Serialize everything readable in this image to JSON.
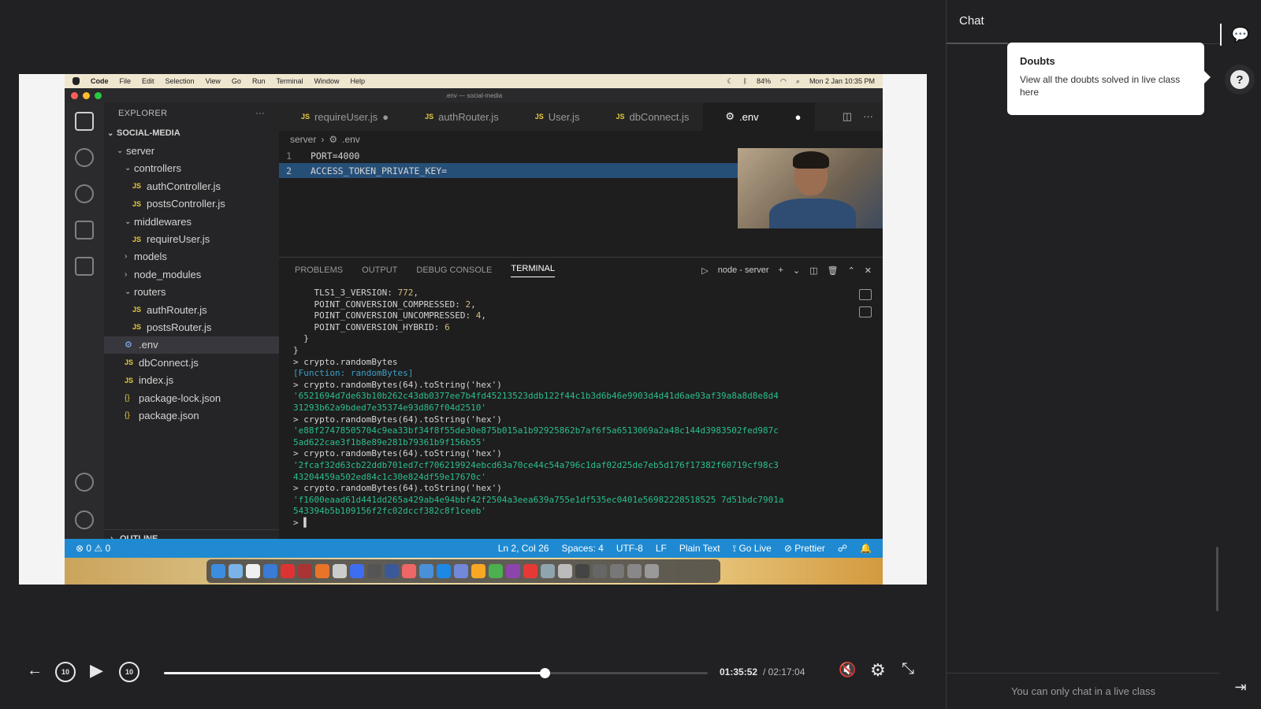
{
  "mac_menubar": {
    "items": [
      "Code",
      "File",
      "Edit",
      "Selection",
      "View",
      "Go",
      "Run",
      "Terminal",
      "Window",
      "Help"
    ],
    "battery": "84%",
    "clock": "Mon 2 Jan  10:35 PM"
  },
  "window_title": ".env — social-media",
  "explorer": {
    "header": "EXPLORER",
    "project": "SOCIAL-MEDIA",
    "tree": [
      {
        "label": "server",
        "kind": "folder-open",
        "depth": 1
      },
      {
        "label": "controllers",
        "kind": "folder-open",
        "depth": 2
      },
      {
        "label": "authController.js",
        "kind": "js",
        "depth": 3
      },
      {
        "label": "postsController.js",
        "kind": "js",
        "depth": 3
      },
      {
        "label": "middlewares",
        "kind": "folder-open",
        "depth": 2
      },
      {
        "label": "requireUser.js",
        "kind": "js",
        "depth": 3
      },
      {
        "label": "models",
        "kind": "folder",
        "depth": 2
      },
      {
        "label": "node_modules",
        "kind": "folder",
        "depth": 2
      },
      {
        "label": "routers",
        "kind": "folder-open",
        "depth": 2
      },
      {
        "label": "authRouter.js",
        "kind": "js",
        "depth": 3
      },
      {
        "label": "postsRouter.js",
        "kind": "js",
        "depth": 3
      },
      {
        "label": ".env",
        "kind": "env",
        "depth": 2,
        "selected": true
      },
      {
        "label": "dbConnect.js",
        "kind": "js",
        "depth": 2
      },
      {
        "label": "index.js",
        "kind": "js",
        "depth": 2
      },
      {
        "label": "package-lock.json",
        "kind": "json",
        "depth": 2
      },
      {
        "label": "package.json",
        "kind": "json",
        "depth": 2
      }
    ],
    "outline": "OUTLINE"
  },
  "tabs": [
    {
      "label": "requireUser.js",
      "modified": true
    },
    {
      "label": "authRouter.js"
    },
    {
      "label": "User.js"
    },
    {
      "label": "dbConnect.js"
    },
    {
      "label": ".env",
      "active": true,
      "modified": true
    }
  ],
  "breadcrumb": {
    "folder": "server",
    "file": ".env"
  },
  "code_lines": [
    {
      "n": "1",
      "text": "PORT=4000"
    },
    {
      "n": "2",
      "text": "ACCESS_TOKEN_PRIVATE_KEY="
    }
  ],
  "panel": {
    "tabs": [
      "PROBLEMS",
      "OUTPUT",
      "DEBUG CONSOLE",
      "TERMINAL"
    ],
    "active_tab": "TERMINAL",
    "terminal_name": "node - server"
  },
  "terminal": {
    "lines": [
      {
        "t": "    TLS1_3_VERSION: ",
        "v": "772",
        "e": ","
      },
      {
        "t": "    POINT_CONVERSION_COMPRESSED: ",
        "v": "2",
        "e": ","
      },
      {
        "t": "    POINT_CONVERSION_UNCOMPRESSED: ",
        "v": "4",
        "e": ","
      },
      {
        "t": "    POINT_CONVERSION_HYBRID: ",
        "v": "6",
        "e": ""
      },
      {
        "t": "  }",
        "v": "",
        "e": ""
      },
      {
        "t": "}",
        "v": "",
        "e": ""
      }
    ],
    "cmd1": "> crypto.randomBytes",
    "fn_out": "[Function: randomBytes]",
    "cmd2": "> crypto.randomBytes(64).toString('hex')",
    "hex_lines": [
      "'6521694d7de63b10b262c43db0377ee7b4fd45213523ddb122f44c1b3d6b46e9903d4d41d6ae93af39a8a8d8e8d4",
      "31293b62a9bded7e35374e93d867f04d2510'",
      "'e88f27478505704c9ea33bf34f8f55de30e875b015a1b92925862b7af6f5a6513069a2a48c144d3983502fed987c",
      "5ad622cae3f1b8e89e281b79361b9f156b55'",
      "'2fcaf32d63cb22ddb701ed7cf706219924ebcd63a70ce44c54a796c1daf02d25de7eb5d176f17382f60719cf98c3",
      "43204459a502ed84c1c30e824df59e17670c'",
      "'f1600eaad61d441dd265a429ab4e94bbf42f2504a3eea639a755e1df535ec0401e56982228518525 7d51bdc7901a",
      "543394b5b109156f2fc02dccf382c8f1ceeb'"
    ],
    "prompt": "> "
  },
  "statusbar": {
    "problems": "0",
    "warnings": "0",
    "position": "Ln 2, Col 26",
    "spaces": "Spaces: 4",
    "encoding": "UTF-8",
    "eol": "LF",
    "language": "Plain Text",
    "golive": "Go Live",
    "prettier": "Prettier"
  },
  "player": {
    "current_time": "01:35:52",
    "duration": "/ 02:17:04",
    "progress": 0.6998,
    "skip_back": "10",
    "skip_fwd": "10"
  },
  "chat": {
    "title": "Chat",
    "footer": "You can only chat in a live class"
  },
  "tooltip": {
    "title": "Doubts",
    "text": "View all the doubts solved in live class here"
  },
  "colors": {
    "accent_statusbar": "#1f8ad2",
    "bg": "#212124",
    "terminal_hex": "#2bbf8a"
  }
}
